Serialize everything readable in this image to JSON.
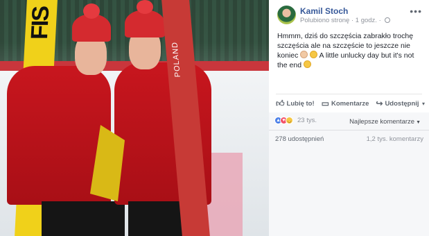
{
  "post": {
    "author": "Kamil Stoch",
    "meta_status": "Polubiono stronę",
    "meta_separator": "·",
    "meta_time": "1 godz.",
    "meta_separator_2": "·",
    "more_label": "•••",
    "text_line1": "Hmmm, dziś do szczęścia zabrakło trochę szczęścia ale na szczęście to jeszcze nie koniec",
    "text_line2": "A little unlucky day but it's not the end"
  },
  "photo": {
    "ski_brand": "FIS",
    "ski_text": "POLAND"
  },
  "actions": {
    "like_label": "Lubię to!",
    "comment_label": "Komentarze",
    "share_label": "Udostępnij",
    "share_dropdown": "▾"
  },
  "stats": {
    "reaction_count": "23 tys.",
    "sort_label": "Najlepsze komentarze",
    "shares": "278 udostępnień",
    "comments": "1,2 tys. komentarzy"
  },
  "colors": {
    "link_blue": "#365899",
    "muted": "#90949c",
    "like_blue": "#4a7ee8",
    "love_red": "#f25268"
  },
  "icons": {
    "like": "thumbs-up-icon",
    "comment": "comment-bubble-icon",
    "share": "share-arrow-icon",
    "privacy": "globe-icon",
    "more": "more-dots-icon"
  }
}
